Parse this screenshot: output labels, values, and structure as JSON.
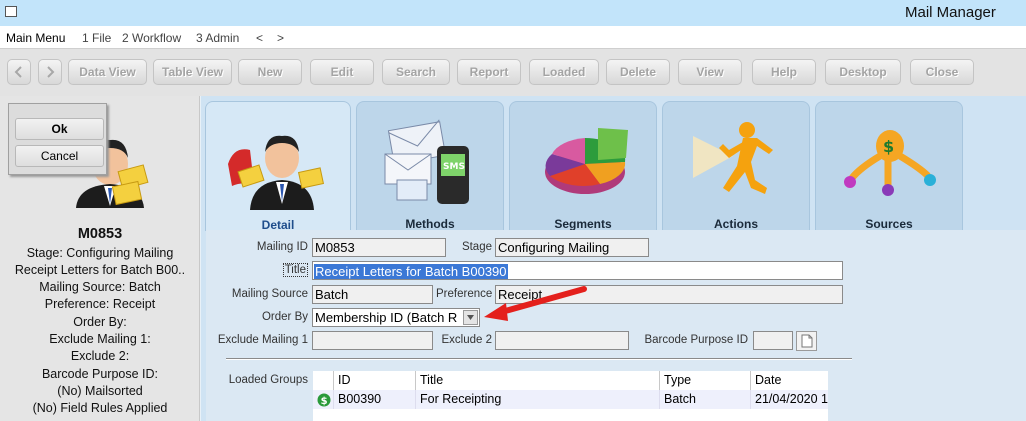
{
  "window": {
    "title": "Mail Manager"
  },
  "menu": {
    "main": "Main Menu",
    "file": "1 File",
    "workflow": "2 Workflow",
    "admin": "3 Admin",
    "back": "<",
    "forward": ">"
  },
  "toolbar": {
    "back_icon": "chevron-left-icon",
    "forward_icon": "chevron-right-icon",
    "buttons": [
      "Data View",
      "Table View",
      "New",
      "Edit",
      "Search",
      "Report",
      "Loaded",
      "Delete",
      "View",
      "Help",
      "Desktop",
      "Close"
    ]
  },
  "dialog": {
    "ok": "Ok",
    "cancel": "Cancel"
  },
  "summary": {
    "code": "M0853",
    "lines": [
      "Stage: Configuring Mailing",
      "Receipt Letters for Batch B00..",
      "Mailing Source: Batch",
      "Preference: Receipt",
      "Order By:",
      "Exclude Mailing 1:",
      "Exclude 2:",
      "Barcode Purpose ID:",
      "(No) Mailsorted",
      "(No) Field Rules Applied"
    ]
  },
  "tabs": [
    {
      "label": "Detail",
      "icon": "person-mail-icon"
    },
    {
      "label": "Methods",
      "icon": "email-sms-icon"
    },
    {
      "label": "Segments",
      "icon": "pie-chart-icon"
    },
    {
      "label": "Actions",
      "icon": "running-man-icon"
    },
    {
      "label": "Sources",
      "icon": "money-bag-icon"
    }
  ],
  "form": {
    "mailing_id_label": "Mailing ID",
    "mailing_id": "M0853",
    "stage_label": "Stage",
    "stage": "Configuring Mailing",
    "title_label": "Title",
    "title": "Receipt Letters for Batch B00390",
    "source_label": "Mailing Source",
    "source": "Batch",
    "preference_label": "Preference",
    "preference": "Receipt",
    "order_label": "Order By",
    "order": "Membership ID (Batch R",
    "exclude1_label": "Exclude Mailing 1",
    "exclude1": "",
    "exclude2_label": "Exclude 2",
    "exclude2": "",
    "barcode_label": "Barcode Purpose ID",
    "barcode": ""
  },
  "loaded_groups": {
    "label": "Loaded Groups",
    "columns": [
      "",
      "ID",
      "Title",
      "Type",
      "Date"
    ],
    "rows": [
      {
        "status_icon": "green-dollar-icon",
        "id": "B00390",
        "title": "For Receipting",
        "type": "Batch",
        "date": "21/04/2020 1"
      }
    ]
  },
  "colors": {
    "titlebar": "#c2e4fa",
    "selection": "#3b78d6",
    "arrow": "#e4201c"
  }
}
